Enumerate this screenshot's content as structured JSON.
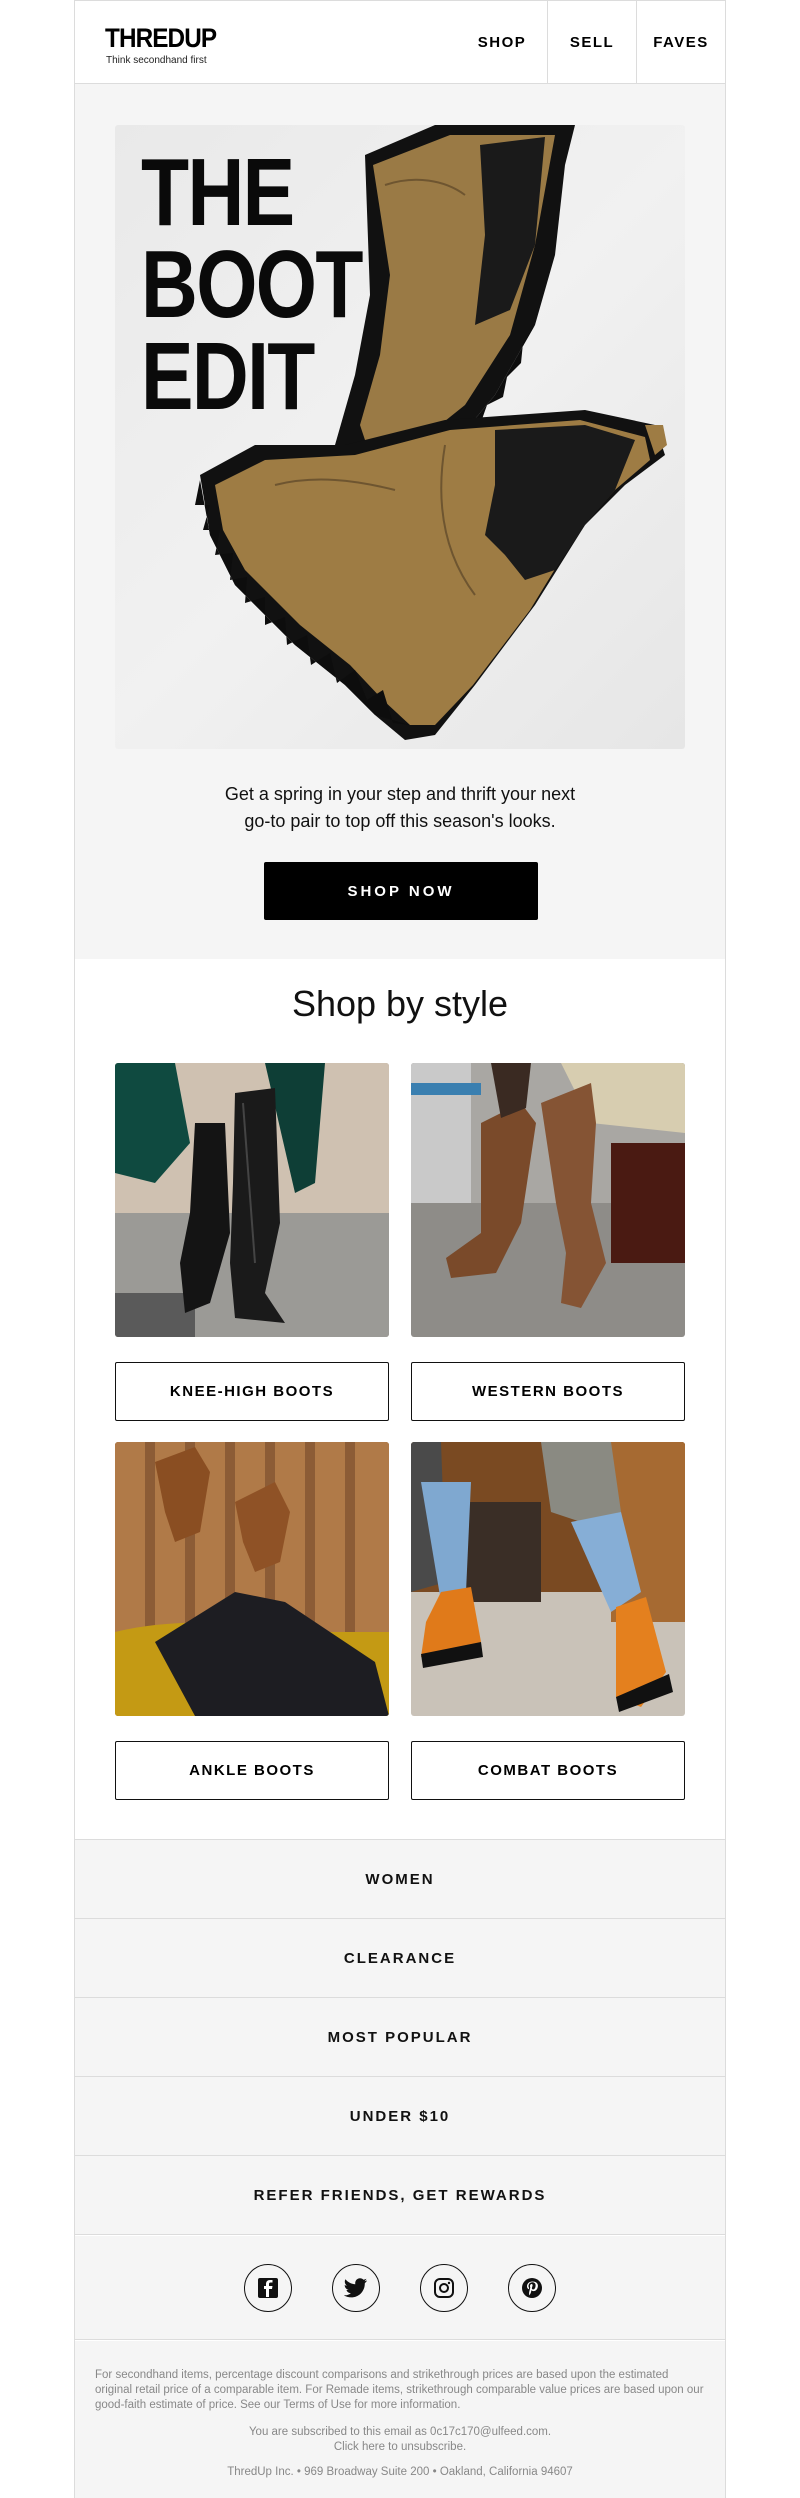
{
  "header": {
    "logo": "THREDUP",
    "tagline": "Think secondhand first",
    "nav": [
      "SHOP",
      "SELL",
      "FAVES"
    ]
  },
  "hero": {
    "title_lines": [
      "THE",
      "BOOT",
      "EDIT"
    ],
    "text_lines": [
      "Get a spring in your step and thrift your next",
      "go-to pair to top off this season's looks."
    ],
    "cta": "SHOP NOW"
  },
  "styles": {
    "title": "Shop by style",
    "items": [
      {
        "label": "KNEE-HIGH BOOTS"
      },
      {
        "label": "WESTERN BOOTS"
      },
      {
        "label": "ANKLE BOOTS"
      },
      {
        "label": "COMBAT BOOTS"
      }
    ]
  },
  "links": [
    "WOMEN",
    "CLEARANCE",
    "MOST POPULAR",
    "UNDER $10",
    "REFER FRIENDS, GET REWARDS"
  ],
  "social": [
    "facebook-icon",
    "twitter-icon",
    "instagram-icon",
    "pinterest-icon"
  ],
  "footer": {
    "disclaimer": "For secondhand items, percentage discount comparisons and strikethrough prices are based upon the estimated original retail price of a comparable item. For Remade items, strikethrough comparable value prices are based upon our good-faith estimate of price. See our Terms of Use for more information.",
    "subscribed": "You are subscribed to this email as 0c17c170@ulfeed.com.",
    "unsubscribe": "Click here to unsubscribe.",
    "address": "ThredUp Inc. • 969 Broadway Suite 200 • Oakland, California 94607"
  },
  "colors": {
    "background": "#ffffff",
    "panel": "#f5f5f5",
    "border": "#dcdcdc",
    "text": "#000000",
    "cta_bg": "#000000",
    "muted": "#888888"
  }
}
